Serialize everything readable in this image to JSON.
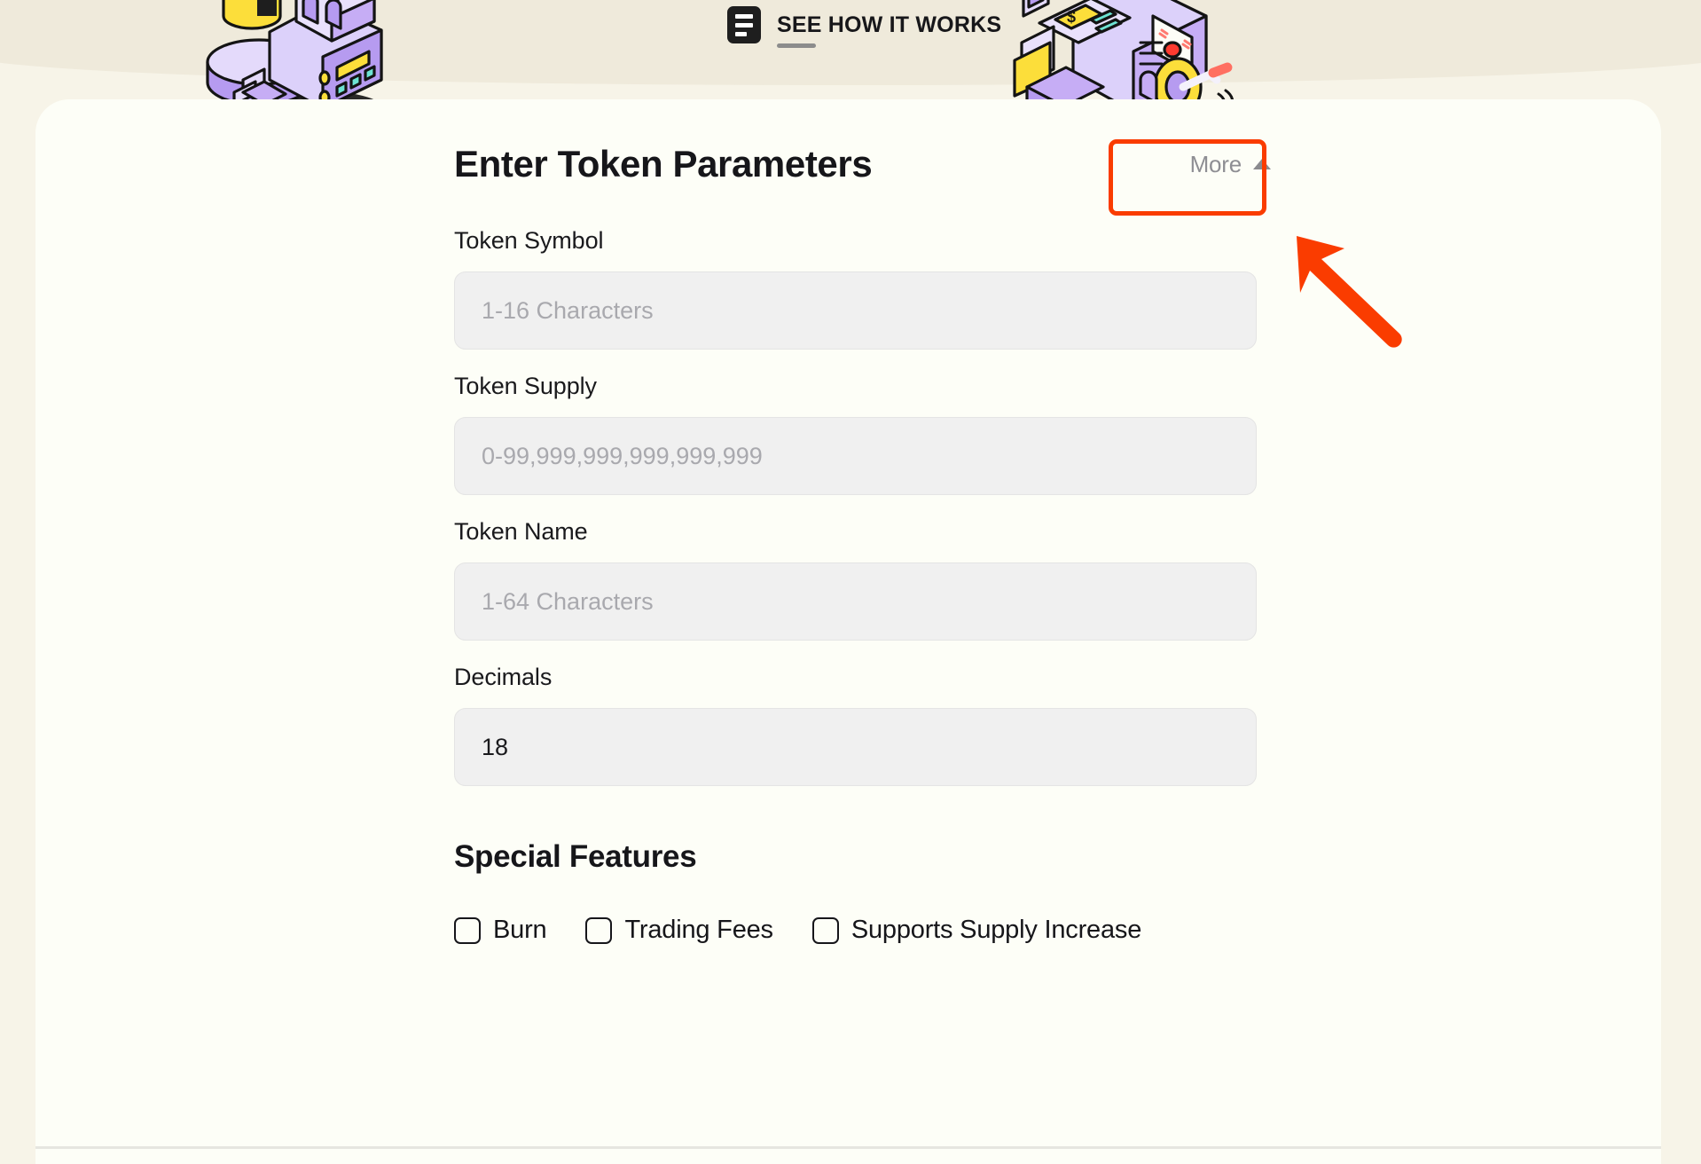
{
  "banner": {
    "icon": "document-lines-icon",
    "link_label": "SEE HOW IT WORKS"
  },
  "illustrations": {
    "left": "token-factory-machine-illustration",
    "right": "money-printing-machine-illustration"
  },
  "form": {
    "title": "Enter Token Parameters",
    "more_button": {
      "label": "More",
      "caret": "chevron-up-icon"
    },
    "fields": [
      {
        "label": "Token Symbol",
        "placeholder": "1-16 Characters",
        "value": ""
      },
      {
        "label": "Token Supply",
        "placeholder": "0-99,999,999,999,999,999",
        "value": ""
      },
      {
        "label": "Token Name",
        "placeholder": "1-64 Characters",
        "value": ""
      },
      {
        "label": "Decimals",
        "placeholder": "",
        "value": "18"
      }
    ]
  },
  "special_features": {
    "title": "Special Features",
    "options": [
      {
        "label": "Burn",
        "checked": false
      },
      {
        "label": "Trading Fees",
        "checked": false
      },
      {
        "label": "Supports Supply Increase",
        "checked": false
      }
    ]
  },
  "annotations": {
    "highlight_target": "More",
    "highlight_color": "#FA3C00",
    "arrow_color": "#FA3C00"
  },
  "colors": {
    "page_background": "#F7F4E8",
    "banner_background": "#EFEADB",
    "card_background": "#FDFEF7",
    "input_background": "#F0F0F0",
    "text_primary": "#16161A",
    "text_muted": "#8E8E93",
    "accent_purple": "#C6ADF5",
    "accent_yellow": "#FCDE3A"
  }
}
